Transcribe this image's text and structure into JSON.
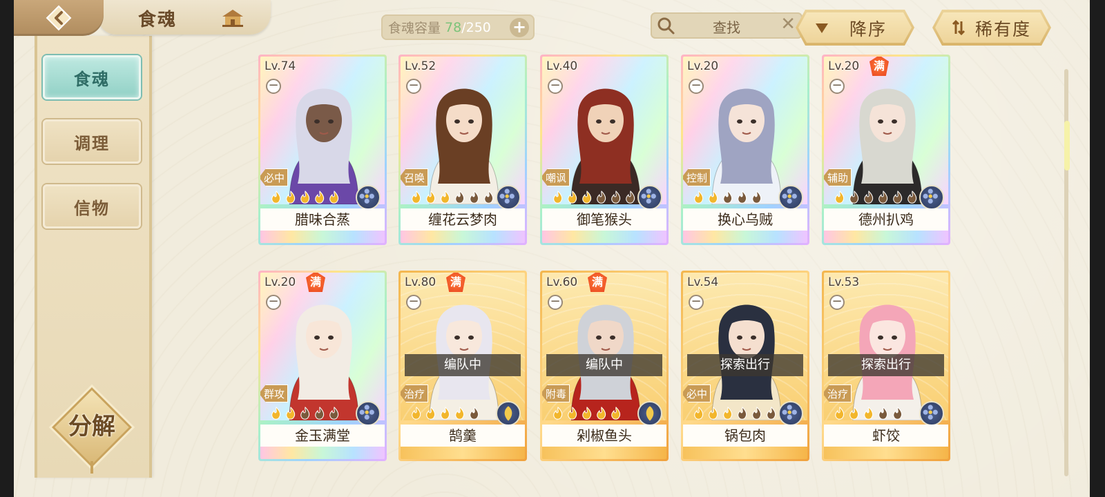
{
  "header": {
    "title": "食魂",
    "capacity": {
      "label": "食魂容量",
      "current": "78",
      "separator": "/",
      "max": "250"
    },
    "search": {
      "placeholder": "查找"
    },
    "sort_order": {
      "label": "降序"
    },
    "sort_key": {
      "label": "稀有度"
    }
  },
  "sidebar": {
    "items": [
      {
        "label": "食魂",
        "active": true
      },
      {
        "label": "调理",
        "active": false
      },
      {
        "label": "信物",
        "active": false
      }
    ],
    "decompose": "分解"
  },
  "cards": [
    {
      "name": "腊味合蒸",
      "level": "Lv.74",
      "role": "必中",
      "full": false,
      "status": "",
      "frame": "rainbow",
      "stars": 5,
      "filled": 5,
      "hair": "#d8d8e8",
      "skin": "#7a5a48",
      "outfit": "#6b48a8",
      "element": "flower"
    },
    {
      "name": "缠花云梦肉",
      "level": "Lv.52",
      "role": "召唤",
      "full": false,
      "status": "",
      "frame": "rainbow",
      "stars": 6,
      "filled": 3,
      "hair": "#6a3f24",
      "skin": "#f5dcc8",
      "outfit": "#f3eee4",
      "element": "flower"
    },
    {
      "name": "御笔猴头",
      "level": "Lv.40",
      "role": "嘲讽",
      "full": false,
      "status": "",
      "frame": "rainbow",
      "stars": 6,
      "filled": 3,
      "hair": "#8e2f22",
      "skin": "#f0d2b8",
      "outfit": "#3b2a25",
      "element": "flower"
    },
    {
      "name": "换心乌贼",
      "level": "Lv.20",
      "role": "控制",
      "full": false,
      "status": "",
      "frame": "rainbow",
      "stars": 5,
      "filled": 2,
      "hair": "#9fa4c2",
      "skin": "#f5e3d8",
      "outfit": "#eef2f8",
      "element": "flower"
    },
    {
      "name": "德州扒鸡",
      "level": "Lv.20",
      "role": "辅助",
      "full": true,
      "full_label": "满",
      "status": "",
      "frame": "rainbow",
      "stars": 6,
      "filled": 1,
      "hair": "#d8d8d0",
      "skin": "#f5e3d8",
      "outfit": "#2c2a2a",
      "element": "flower"
    },
    {
      "name": "金玉满堂",
      "level": "Lv.20",
      "role": "群攻",
      "full": true,
      "full_label": "满",
      "status": "",
      "frame": "rainbow",
      "stars": 5,
      "filled": 2,
      "hair": "#f2ece4",
      "skin": "#f8e6d8",
      "outfit": "#c2362e",
      "element": "flower"
    },
    {
      "name": "鹄羹",
      "level": "Lv.80",
      "role": "治疗",
      "full": true,
      "full_label": "满",
      "status": "编队中",
      "frame": "gold",
      "stars": 5,
      "filled": 4,
      "hair": "#e8e6ef",
      "skin": "#f8e8dc",
      "outfit": "#f4efe4",
      "element": "leaf"
    },
    {
      "name": "剁椒鱼头",
      "level": "Lv.60",
      "role": "附毒",
      "full": true,
      "full_label": "满",
      "status": "编队中",
      "frame": "gold",
      "stars": 5,
      "filled": 5,
      "hair": "#cfd2d8",
      "skin": "#f0d8c8",
      "outfit": "#b7241d",
      "element": "leaf"
    },
    {
      "name": "锅包肉",
      "level": "Lv.54",
      "role": "必中",
      "full": false,
      "status": "探索出行",
      "frame": "gold",
      "stars": 6,
      "filled": 3,
      "hair": "#2a3040",
      "skin": "#f5dfcf",
      "outfit": "#f3e6c8",
      "element": "flower"
    },
    {
      "name": "虾饺",
      "level": "Lv.53",
      "role": "治疗",
      "full": false,
      "status": "探索出行",
      "frame": "gold",
      "stars": 5,
      "filled": 3,
      "hair": "#f4a6b8",
      "skin": "#fbe6e0",
      "outfit": "#f4f0ea",
      "element": "flower"
    }
  ]
}
